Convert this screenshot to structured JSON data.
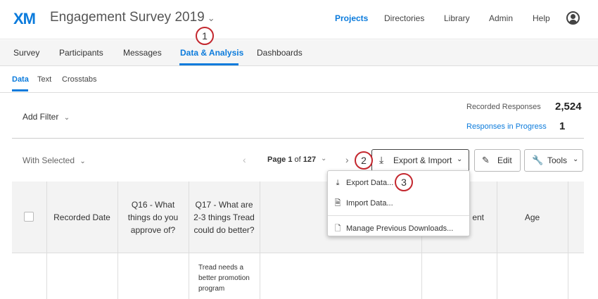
{
  "header": {
    "logo": "XM",
    "project_title": "Engagement Survey 2019",
    "project_caret": "⌄",
    "nav": [
      "Projects",
      "Directories",
      "Library",
      "Admin",
      "Help"
    ]
  },
  "tabs": [
    "Survey",
    "Participants",
    "Messages",
    "Data & Analysis",
    "Dashboards"
  ],
  "subtabs": [
    "Data",
    "Text",
    "Crosstabs"
  ],
  "filter": {
    "add_filter_label": "Add Filter",
    "recorded_label": "Recorded Responses",
    "recorded_value": "2,524",
    "in_progress_label": "Responses in Progress",
    "in_progress_value": "1"
  },
  "toolbar": {
    "with_selected": "With Selected",
    "page_prefix": "Page ",
    "page_current": "1",
    "page_of": " of ",
    "page_total": "127",
    "export_label": "Export & Import",
    "edit_label": "Edit",
    "tools_label": "Tools"
  },
  "table": {
    "headers": [
      "Recorded Date",
      "Q16 - What things do you approve of?",
      "Q17 - What are 2-3 things Tread could do better?",
      "",
      "ent",
      "Age"
    ],
    "row1_q17": "Tread needs a better promotion program"
  },
  "dropdown": {
    "items": [
      "Export Data...",
      "Import Data...",
      "Manage Previous Downloads..."
    ]
  },
  "callouts": [
    "1",
    "2",
    "3"
  ],
  "colors": {
    "accent": "#0b7bdc",
    "callout": "#c3272e"
  }
}
